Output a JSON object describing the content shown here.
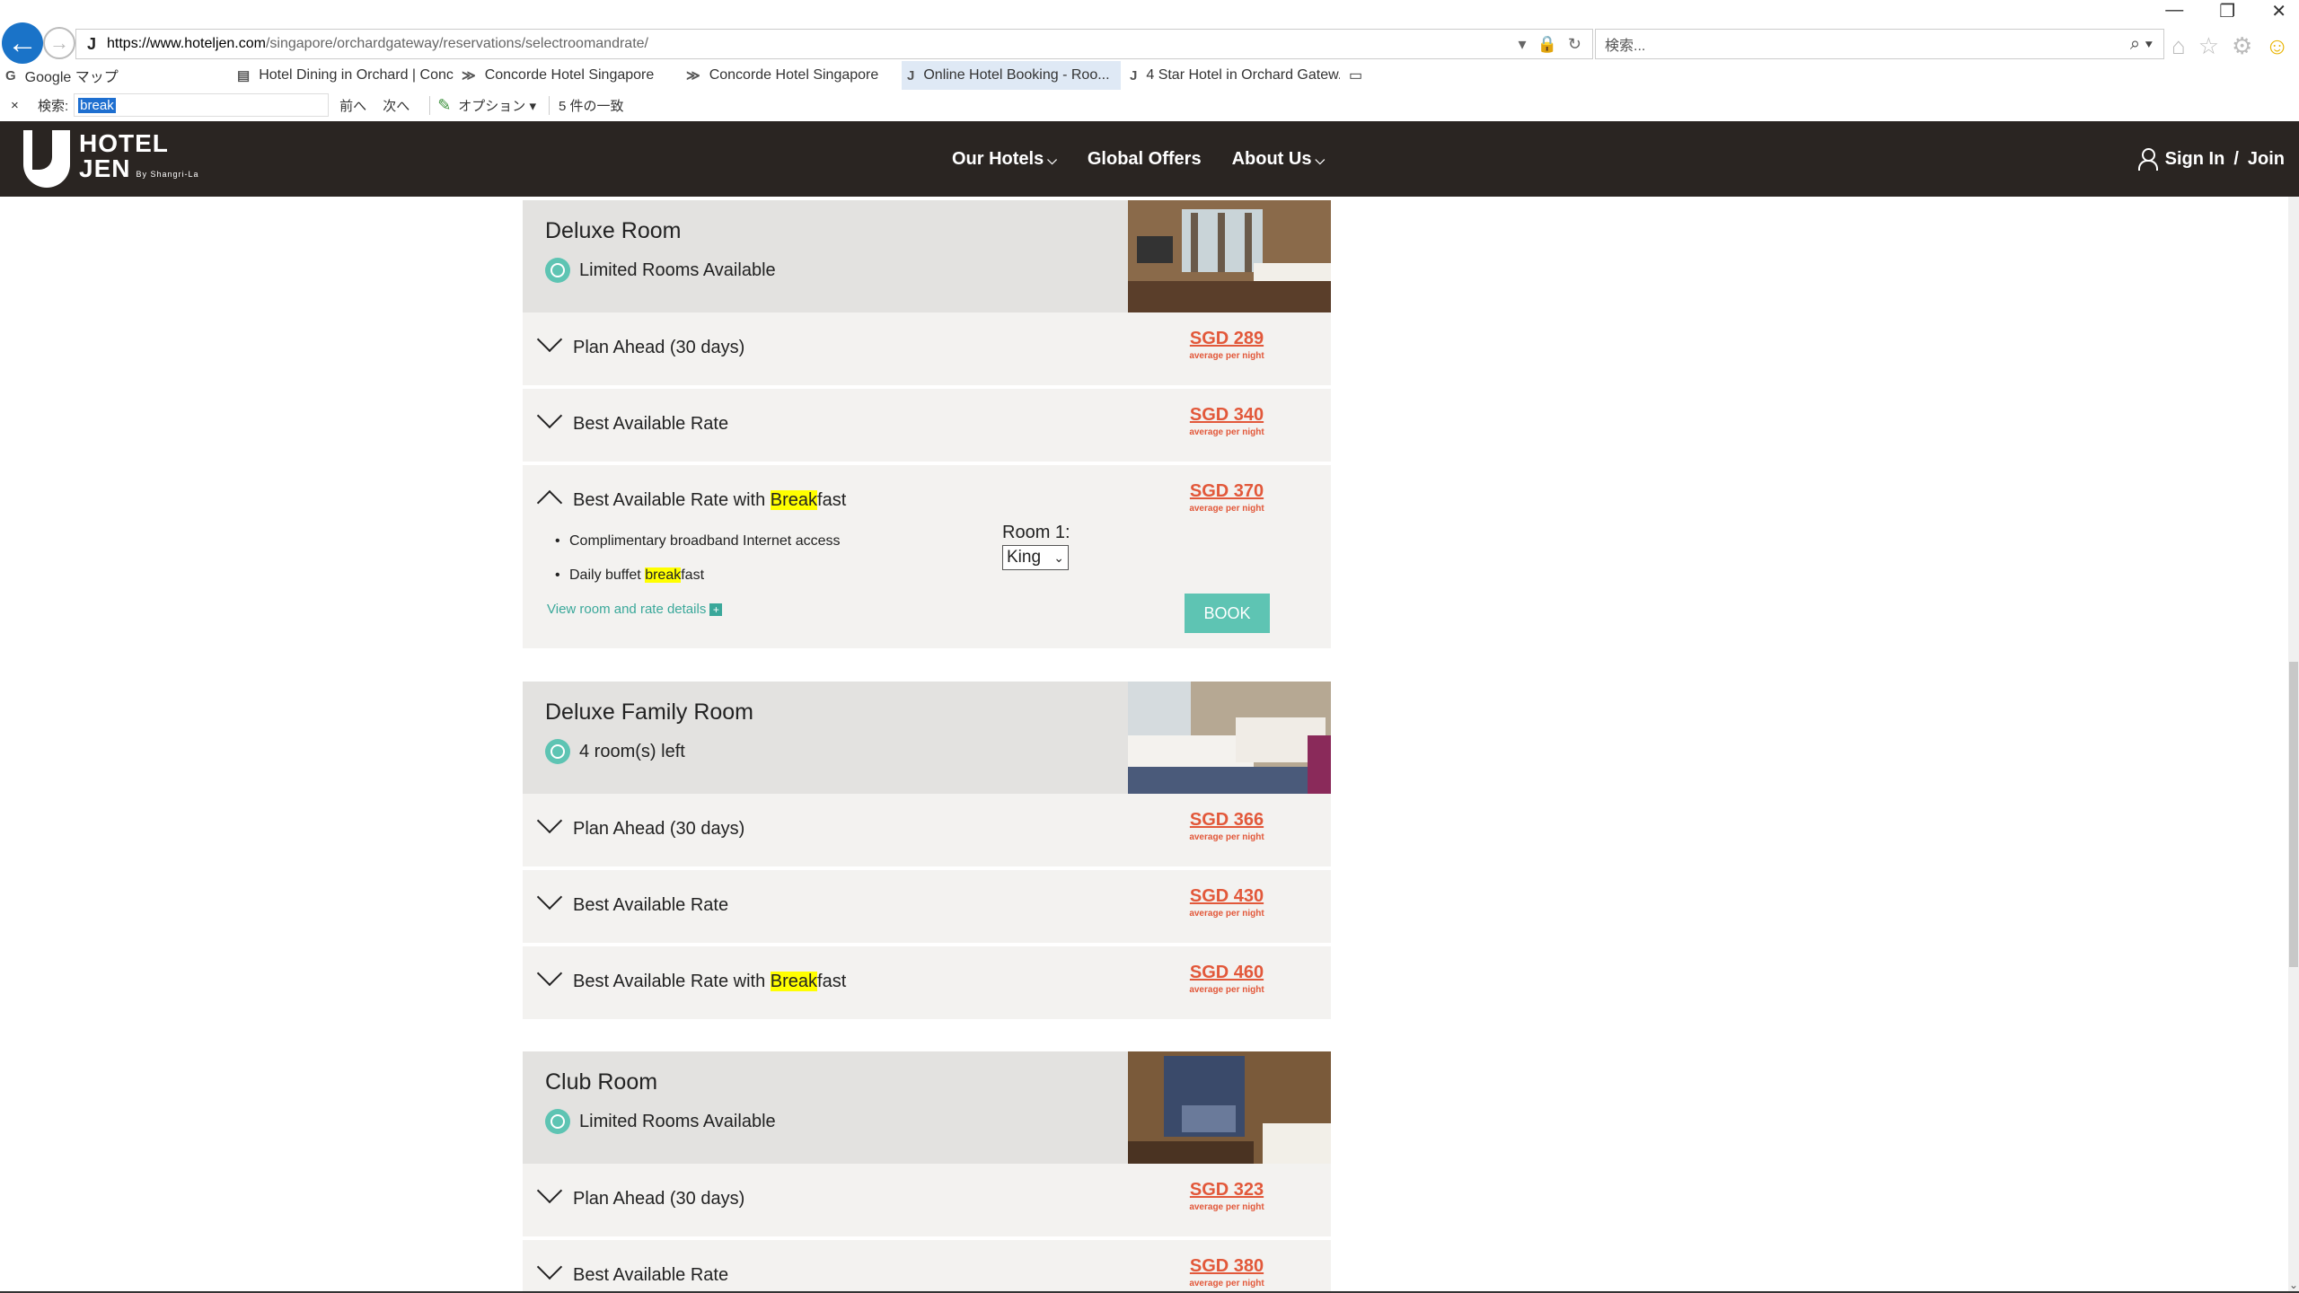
{
  "browser": {
    "url_host": "https://www.hoteljen.com",
    "url_path": "/singapore/orchardgateway/reservations/selectroomandrate/",
    "search_placeholder": "検索...",
    "tabs": [
      {
        "label": "Google マップ",
        "icon": "G"
      },
      {
        "label": "Hotel Dining in Orchard | Conc...",
        "icon": "▤"
      },
      {
        "label": "Concorde Hotel Singapore",
        "icon": "≫"
      },
      {
        "label": "Concorde Hotel Singapore",
        "icon": "≫"
      },
      {
        "label": "Online Hotel Booking - Roo...",
        "icon": "J",
        "close": "×"
      },
      {
        "label": "4 Star Hotel in Orchard Gatew...",
        "icon": "J"
      }
    ],
    "find": {
      "close": "×",
      "label": "検索:",
      "query": "break",
      "prev": "前へ",
      "next": "次へ",
      "options": "オプション ▾",
      "count": "5 件の一致"
    }
  },
  "site": {
    "logo_line1": "HOTEL",
    "logo_line2": "JEN",
    "logo_sub": "By Shangri-La",
    "nav": [
      "Our Hotels",
      "Global Offers",
      "About Us"
    ],
    "sign_in": "Sign In",
    "sep": "/",
    "join": "Join"
  },
  "rooms": [
    {
      "name": "Deluxe Room",
      "availability": "Limited Rooms Available",
      "rates": [
        {
          "pre": "Plan Ahead (30 days)",
          "hl": "",
          "post": "",
          "price": "SGD 289"
        },
        {
          "pre": "Best Available Rate",
          "hl": "",
          "post": "",
          "price": "SGD 340"
        },
        {
          "pre": "Best Available Rate with ",
          "hl": "Break",
          "post": "fast",
          "price": "SGD 370",
          "expanded": true,
          "bullets": [
            {
              "pre": "Complimentary broadband Internet access",
              "hl": "",
              "post": ""
            },
            {
              "pre": "Daily buffet ",
              "hl": "break",
              "post": "fast"
            }
          ],
          "details_link": "View room and rate details",
          "room_label": "Room 1:",
          "bed": "King",
          "book": "BOOK"
        }
      ]
    },
    {
      "name": "Deluxe Family Room",
      "availability": "4 room(s) left",
      "rates": [
        {
          "pre": "Plan Ahead (30 days)",
          "hl": "",
          "post": "",
          "price": "SGD 366"
        },
        {
          "pre": "Best Available Rate",
          "hl": "",
          "post": "",
          "price": "SGD 430"
        },
        {
          "pre": "Best Available Rate with ",
          "hl": "Break",
          "post": "fast",
          "price": "SGD 460"
        }
      ]
    },
    {
      "name": "Club Room",
      "availability": "Limited Rooms Available",
      "rates": [
        {
          "pre": "Plan Ahead (30 days)",
          "hl": "",
          "post": "",
          "price": "SGD 323"
        },
        {
          "pre": "Best Available Rate",
          "hl": "",
          "post": "",
          "price": "SGD 380"
        }
      ]
    }
  ],
  "price_note": "average per night",
  "colors": {
    "header_bg": "#2a2522",
    "price": "#e2583a",
    "accent": "#5ec4b3",
    "highlight": "#ffff00"
  }
}
